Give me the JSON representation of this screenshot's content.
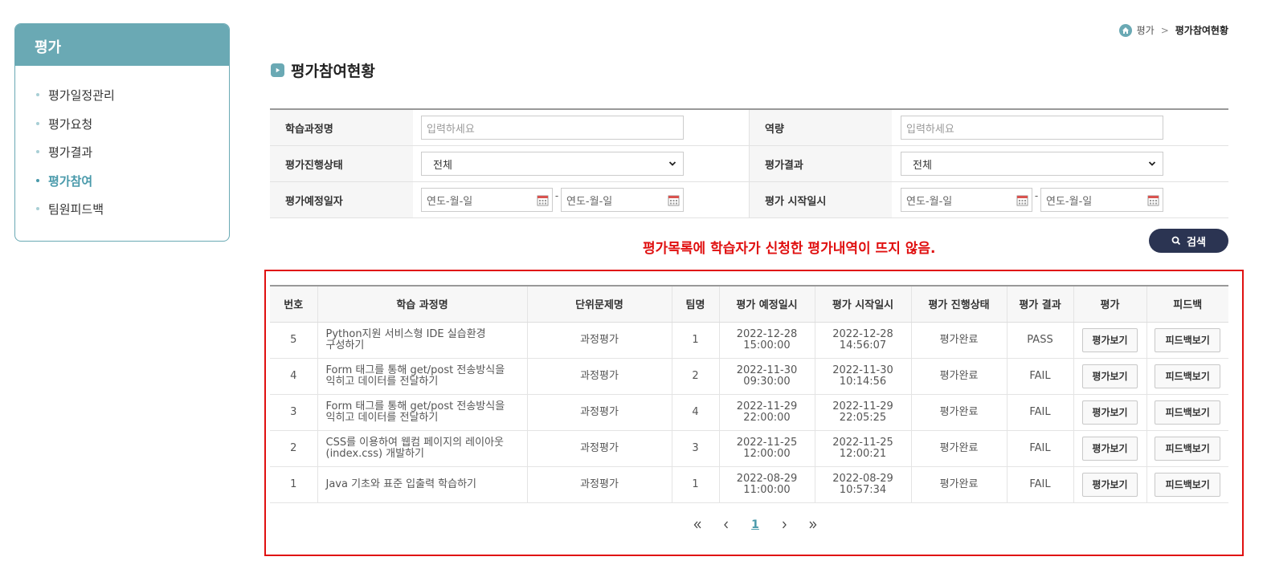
{
  "sidebar": {
    "title": "평가",
    "items": [
      {
        "label": "평가일정관리",
        "active": false
      },
      {
        "label": "평가요청",
        "active": false
      },
      {
        "label": "평가결과",
        "active": false
      },
      {
        "label": "평가참여",
        "active": true
      },
      {
        "label": "팀원피드백",
        "active": false
      }
    ]
  },
  "breadcrumb": {
    "home_icon": "home-icon",
    "parent": "평가",
    "current": "평가참여현황"
  },
  "page_title": "평가참여현황",
  "search_form": {
    "course_name_label": "학습과정명",
    "course_name_placeholder": "입력하세요",
    "competency_label": "역량",
    "competency_placeholder": "입력하세요",
    "progress_status_label": "평가진행상태",
    "progress_status_value": "전체",
    "result_label": "평가결과",
    "result_value": "전체",
    "scheduled_date_label": "평가예정일자",
    "start_date_label": "평가 시작일시",
    "date_placeholder": "연도-월-일",
    "date_separator": "-"
  },
  "search_button": "검색",
  "notice": "평가목록에 학습자가 신청한 평가내역이 뜨지 않음.",
  "table": {
    "headers": [
      "번호",
      "학습 과정명",
      "단위문제명",
      "팀명",
      "평가 예정일시",
      "평가 시작일시",
      "평가 진행상태",
      "평가 결과",
      "평가",
      "피드백"
    ],
    "rows": [
      {
        "no": "5",
        "course_line1": "Python지원 서비스형 IDE 실습환경",
        "course_line2": "구성하기",
        "unit": "과정평가",
        "team": "1",
        "sched_date": "2022-12-28",
        "sched_time": "15:00:00",
        "start_date": "2022-12-28",
        "start_time": "14:56:07",
        "status": "평가완료",
        "result": "PASS"
      },
      {
        "no": "4",
        "course_line1": "Form 태그를 통해 get/post 전송방식을",
        "course_line2": "익히고 데이터를 전달하기",
        "unit": "과정평가",
        "team": "2",
        "sched_date": "2022-11-30",
        "sched_time": "09:30:00",
        "start_date": "2022-11-30",
        "start_time": "10:14:56",
        "status": "평가완료",
        "result": "FAIL"
      },
      {
        "no": "3",
        "course_line1": "Form 태그를 통해 get/post 전송방식을",
        "course_line2": "익히고 데이터를 전달하기",
        "unit": "과정평가",
        "team": "4",
        "sched_date": "2022-11-29",
        "sched_time": "22:00:00",
        "start_date": "2022-11-29",
        "start_time": "22:05:25",
        "status": "평가완료",
        "result": "FAIL"
      },
      {
        "no": "2",
        "course_line1": "CSS를 이용하여 웹컴 페이지의 레이아웃",
        "course_line2": "(index.css) 개발하기",
        "unit": "과정평가",
        "team": "3",
        "sched_date": "2022-11-25",
        "sched_time": "12:00:00",
        "start_date": "2022-11-25",
        "start_time": "12:00:21",
        "status": "평가완료",
        "result": "FAIL"
      },
      {
        "no": "1",
        "course_line1": "Java 기초와 표준 입출력 학습하기",
        "course_line2": "",
        "unit": "과정평가",
        "team": "1",
        "sched_date": "2022-08-29",
        "sched_time": "11:00:00",
        "start_date": "2022-08-29",
        "start_time": "10:57:34",
        "status": "평가완료",
        "result": "FAIL"
      }
    ],
    "eval_button": "평가보기",
    "feedback_button": "피드백보기"
  },
  "pagination": {
    "current_page": "1"
  },
  "colors": {
    "accent": "#6aa9b4",
    "button_dark": "#2b3452",
    "notice_red": "#e01010"
  }
}
